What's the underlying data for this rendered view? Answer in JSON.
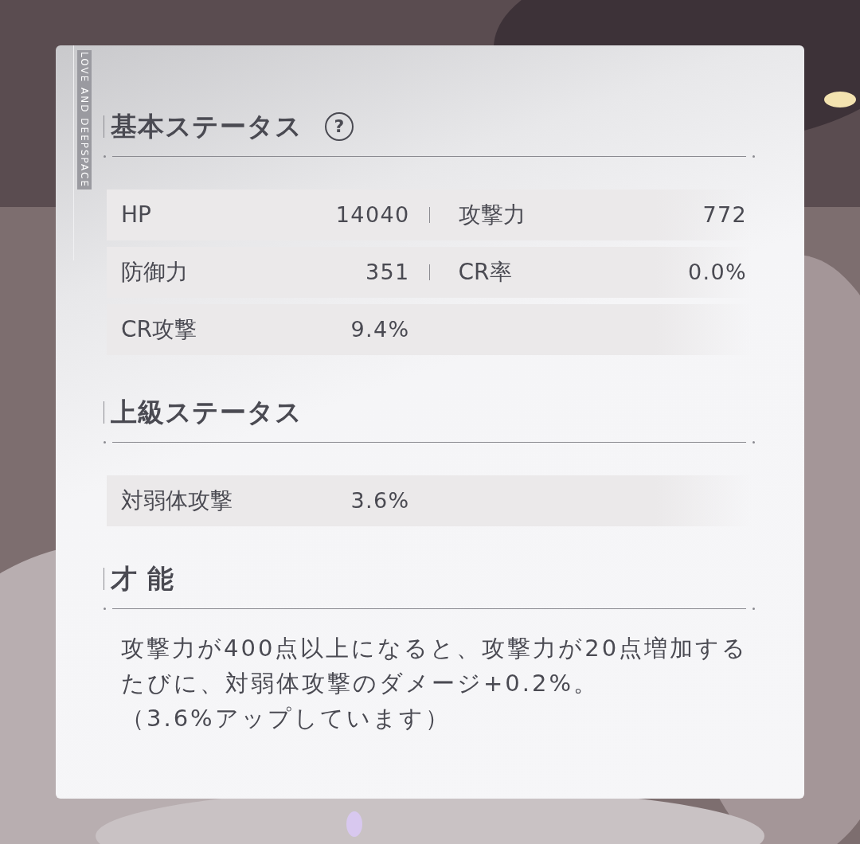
{
  "brand": "LOVE AND DEEPSPACE",
  "sections": [
    {
      "kind": "stats",
      "title": "基本ステータス",
      "help": "?",
      "rows": [
        {
          "cells": [
            {
              "label": "HP",
              "value": "14040"
            },
            {
              "label": "攻撃力",
              "value": "772"
            }
          ]
        },
        {
          "cells": [
            {
              "label": "防御力",
              "value": "351"
            },
            {
              "label": "CR率",
              "value": "0.0%"
            }
          ]
        },
        {
          "cells": [
            {
              "label": "CR攻撃",
              "value": "9.4%"
            }
          ]
        }
      ]
    },
    {
      "kind": "stats",
      "title": "上級ステータス",
      "rows": [
        {
          "cells": [
            {
              "label": "対弱体攻撃",
              "value": "3.6%"
            }
          ]
        }
      ]
    },
    {
      "kind": "text",
      "title": "才 能",
      "lines": [
        "攻撃力が400点以上になると、攻撃力が20点増加するたびに、対弱体攻撃のダメージ+0.2%。",
        "（3.6%アップしています）"
      ]
    }
  ]
}
